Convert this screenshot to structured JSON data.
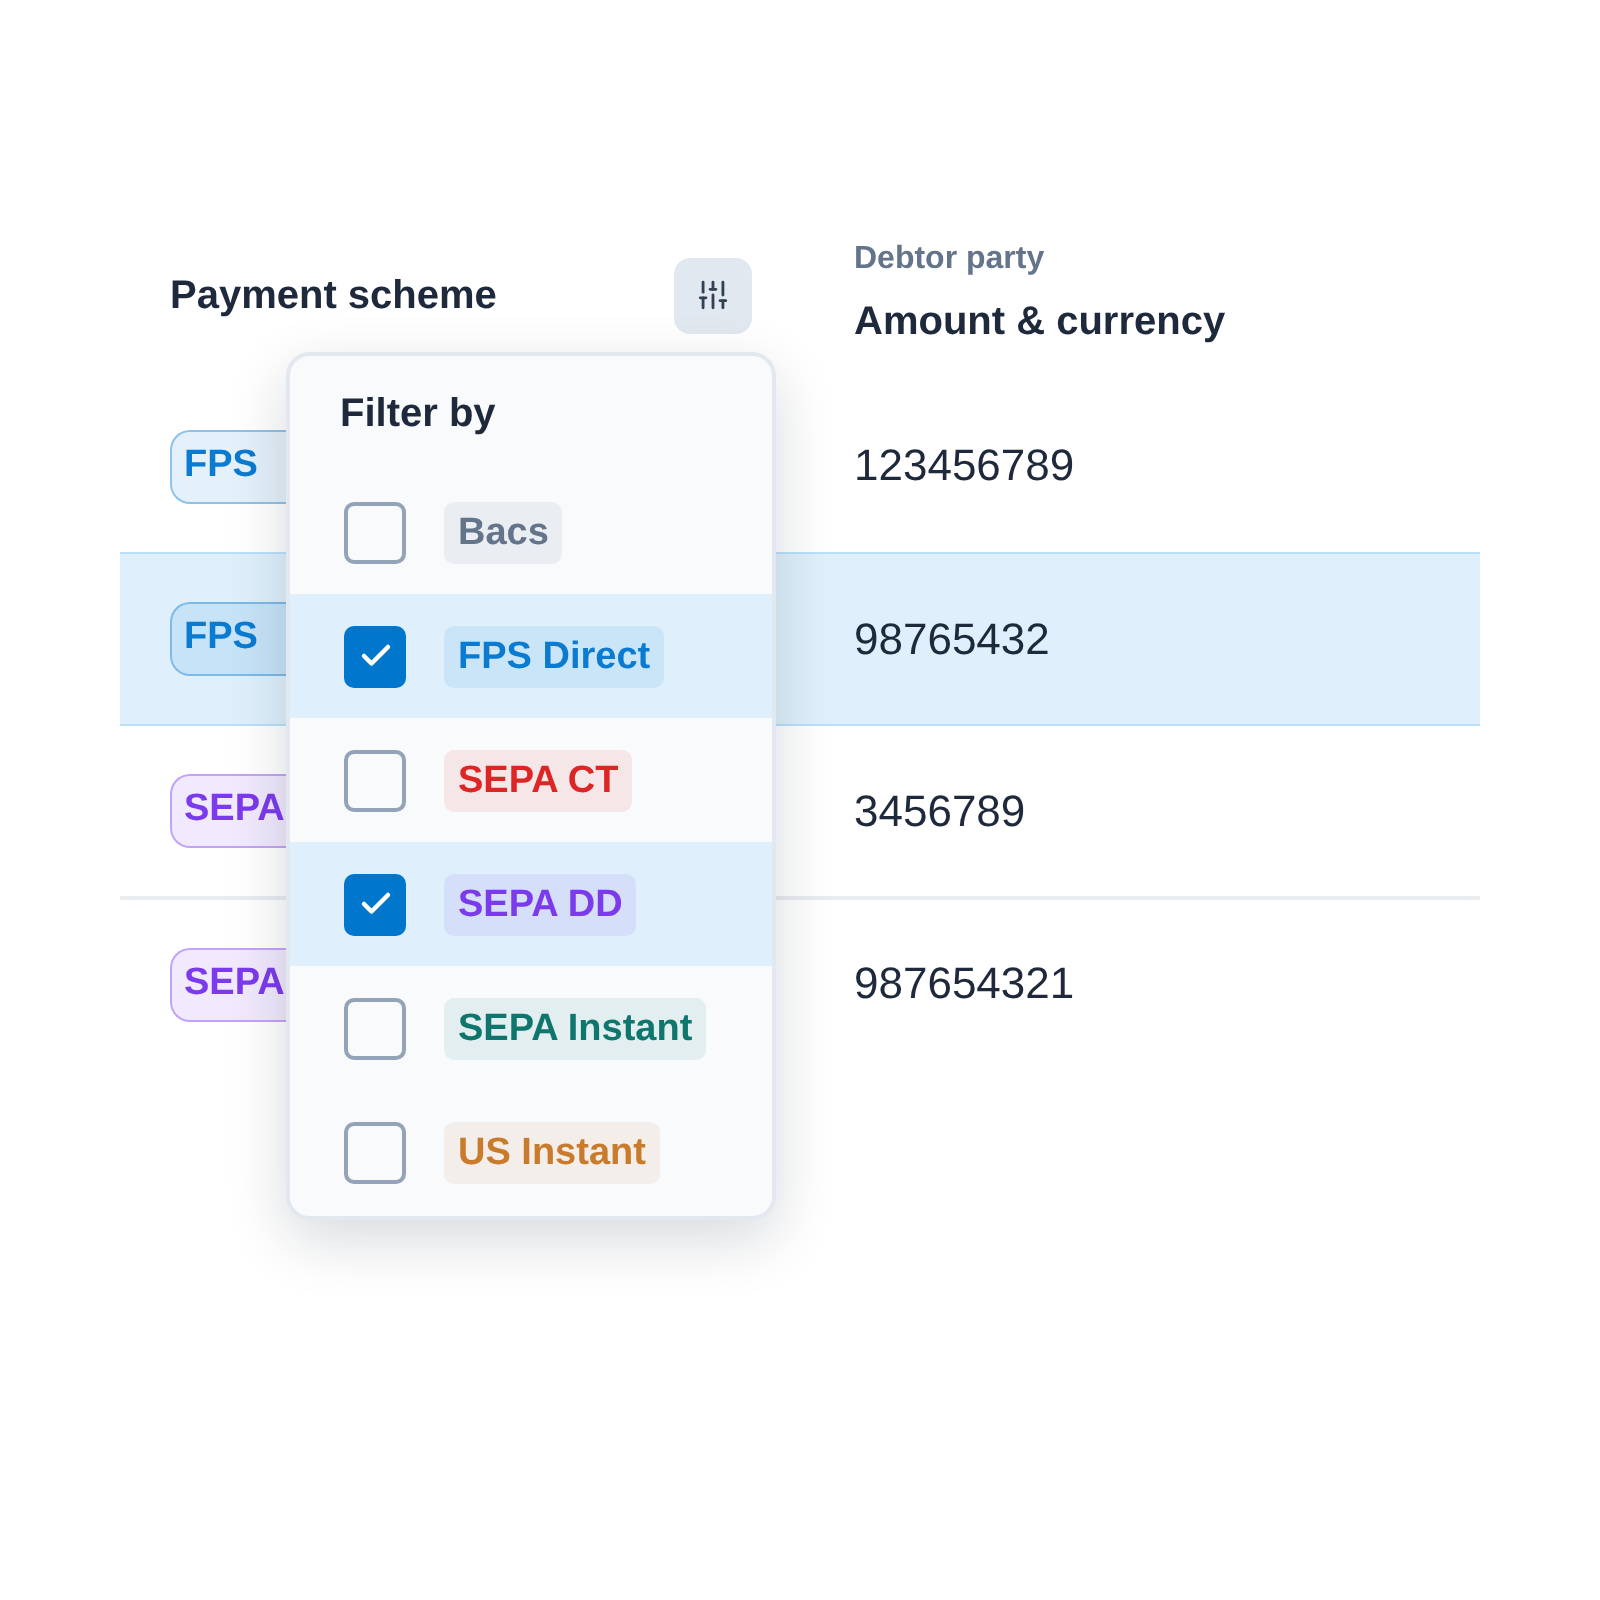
{
  "table": {
    "columns": [
      {
        "label": "Payment scheme"
      },
      {
        "sublabel": "Debtor party",
        "label": "Amount & currency"
      }
    ],
    "rows": [
      {
        "scheme": "FPS",
        "color": "#0a7bd1",
        "amount": "123456789",
        "selected": false
      },
      {
        "scheme": "FPS",
        "color": "#0a7bd1",
        "amount": "98765432",
        "selected": true
      },
      {
        "scheme": "SEPA",
        "color": "#7c3aed",
        "amount": "3456789",
        "selected": false
      },
      {
        "scheme": "SEPA",
        "color": "#7c3aed",
        "amount": "987654321",
        "selected": false
      }
    ]
  },
  "filter_menu": {
    "title": "Filter by",
    "options": [
      {
        "label": "Bacs",
        "color": "#64748b",
        "checked": false
      },
      {
        "label": "FPS Direct",
        "color": "#0a7bd1",
        "checked": true
      },
      {
        "label": "SEPA CT",
        "color": "#dc2626",
        "checked": false
      },
      {
        "label": "SEPA DD",
        "color": "#7c3aed",
        "checked": true
      },
      {
        "label": "SEPA Instant",
        "color": "#0f766e",
        "checked": false
      },
      {
        "label": "US Instant",
        "color": "#c97a2a",
        "checked": false
      }
    ]
  }
}
